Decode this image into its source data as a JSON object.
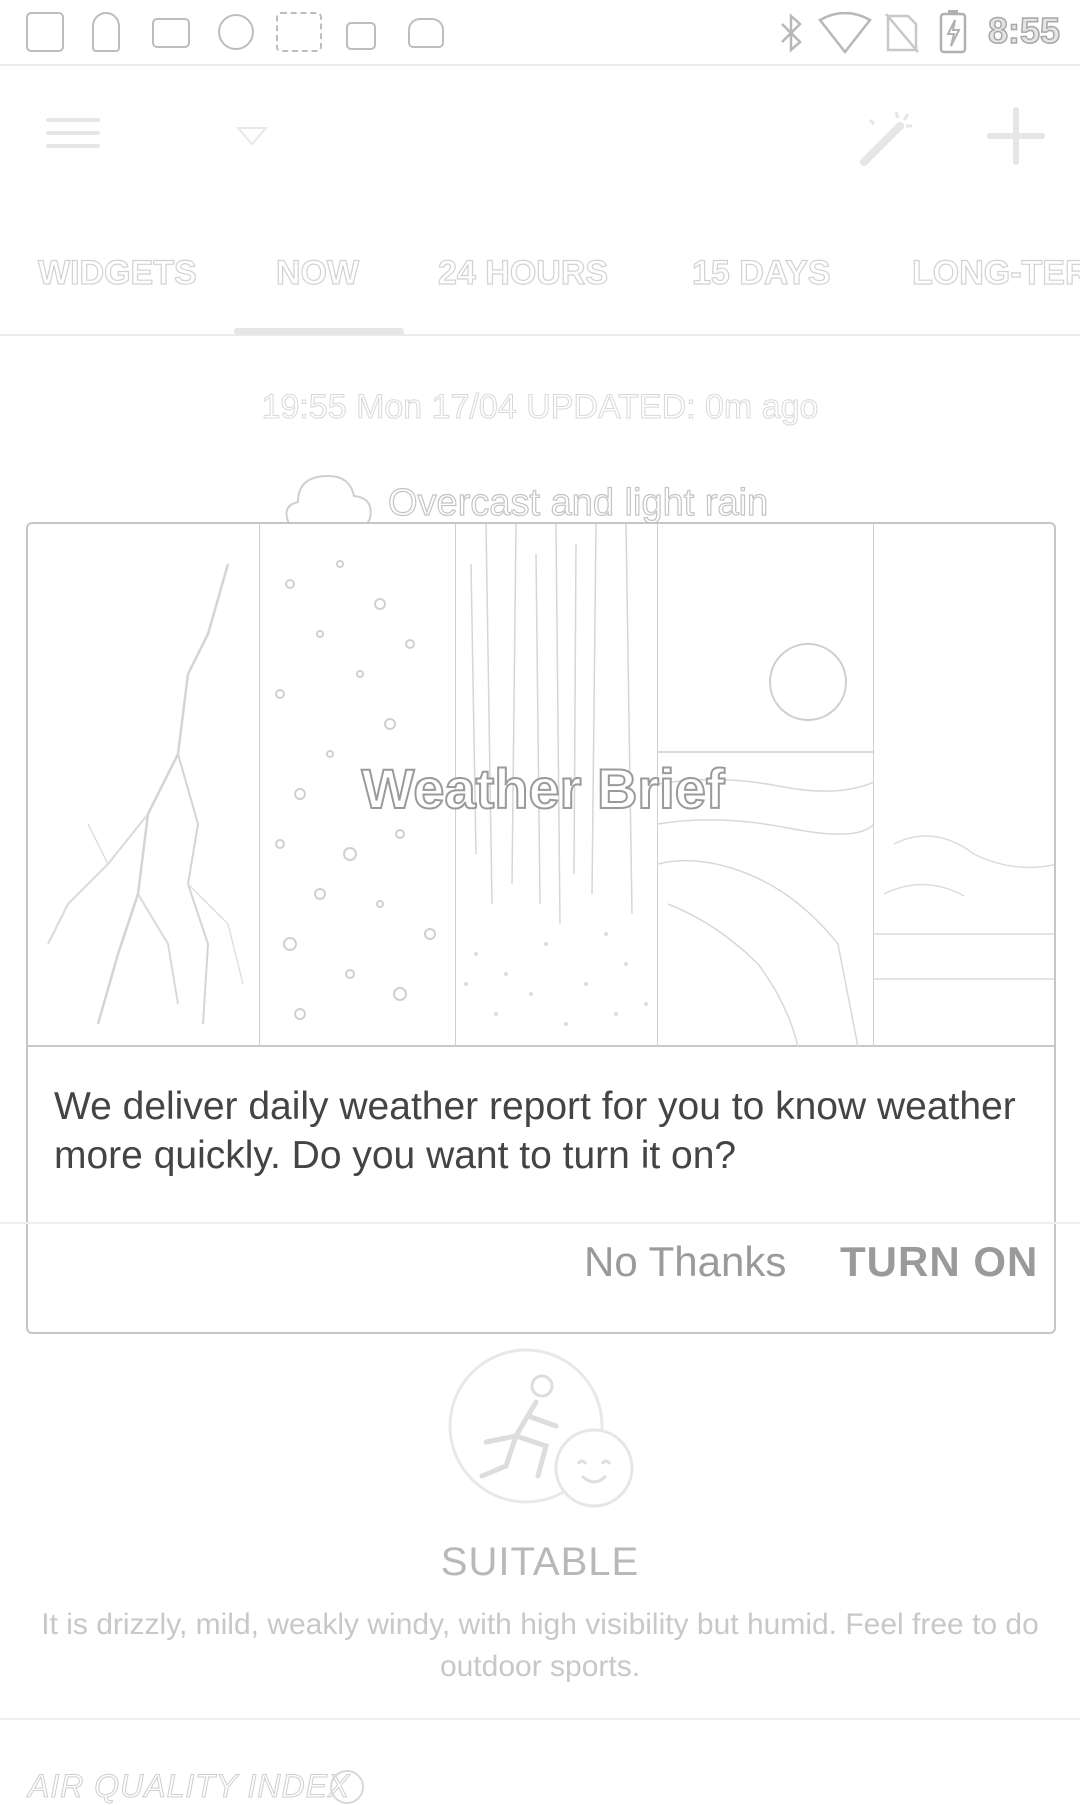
{
  "status_bar": {
    "time": "8:55",
    "left_icons": [
      "facebook-icon",
      "keyhole-icon",
      "mail-icon",
      "opera-icon",
      "weather-app-icon",
      "lock-icon",
      "android-icon"
    ],
    "right_icons": [
      "bluetooth-icon",
      "wifi-icon",
      "no-sim-icon",
      "battery-charging-icon"
    ]
  },
  "tabs": [
    "WIDGETS",
    "NOW",
    "24 HOURS",
    "15 DAYS",
    "LONG-TER"
  ],
  "active_tab": "NOW",
  "now": {
    "updated": "19:55 Mon 17/04 UPDATED: 0m ago",
    "condition": "Overcast and light rain"
  },
  "dialog": {
    "banner_title": "Weather Brief",
    "message": "We deliver daily weather report for you to know weather more quickly. Do you want to turn it on?",
    "no_thanks": "No Thanks",
    "turn_on": "TURN ON"
  },
  "sport": {
    "status": "SUITABLE",
    "description": "It is drizzly, mild, weakly windy, with high visibility but humid. Feel free to do outdoor sports."
  },
  "air_quality": {
    "label": "AIR QUALITY INDEX"
  }
}
